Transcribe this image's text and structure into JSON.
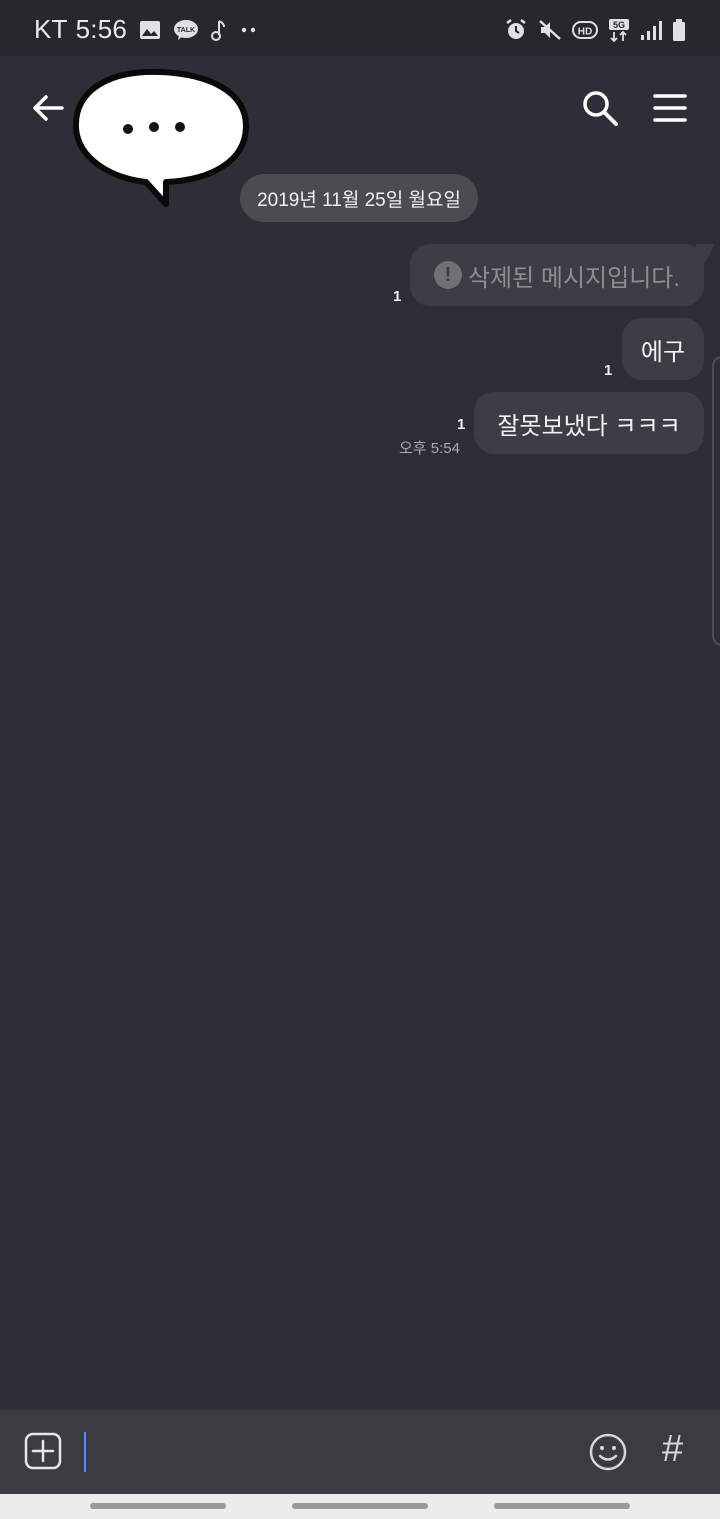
{
  "status_bar": {
    "carrier": "KT",
    "time": "5:56",
    "left_icons": [
      "gallery-icon",
      "kakaotalk-icon",
      "music-icon",
      "more-dots-icon"
    ],
    "right_icons": [
      "alarm-icon",
      "mute-icon",
      "hd-icon",
      "5g-icon",
      "signal-icon",
      "battery-icon"
    ]
  },
  "header": {
    "avatar_sticker": "speech-bubble-sticker",
    "back_icon": "back-arrow-icon",
    "search_icon": "search-icon",
    "menu_icon": "menu-icon"
  },
  "chat": {
    "date_separator": "2019년 11월 25일 월요일",
    "messages": [
      {
        "text": "삭제된 메시지입니다.",
        "unread": "1",
        "deleted": true
      },
      {
        "text": "에구",
        "unread": "1"
      },
      {
        "text": "잘못보냈다 ㅋㅋㅋ",
        "unread": "1",
        "time": "오후 5:54"
      }
    ]
  },
  "input_bar": {
    "plus_icon": "plus-square-icon",
    "emoji_icon": "emoji-icon",
    "hash_label": "#"
  },
  "colors": {
    "background": "#2c2f36",
    "bubble": "#3b3e44",
    "accent_cursor": "#4b8cff"
  }
}
